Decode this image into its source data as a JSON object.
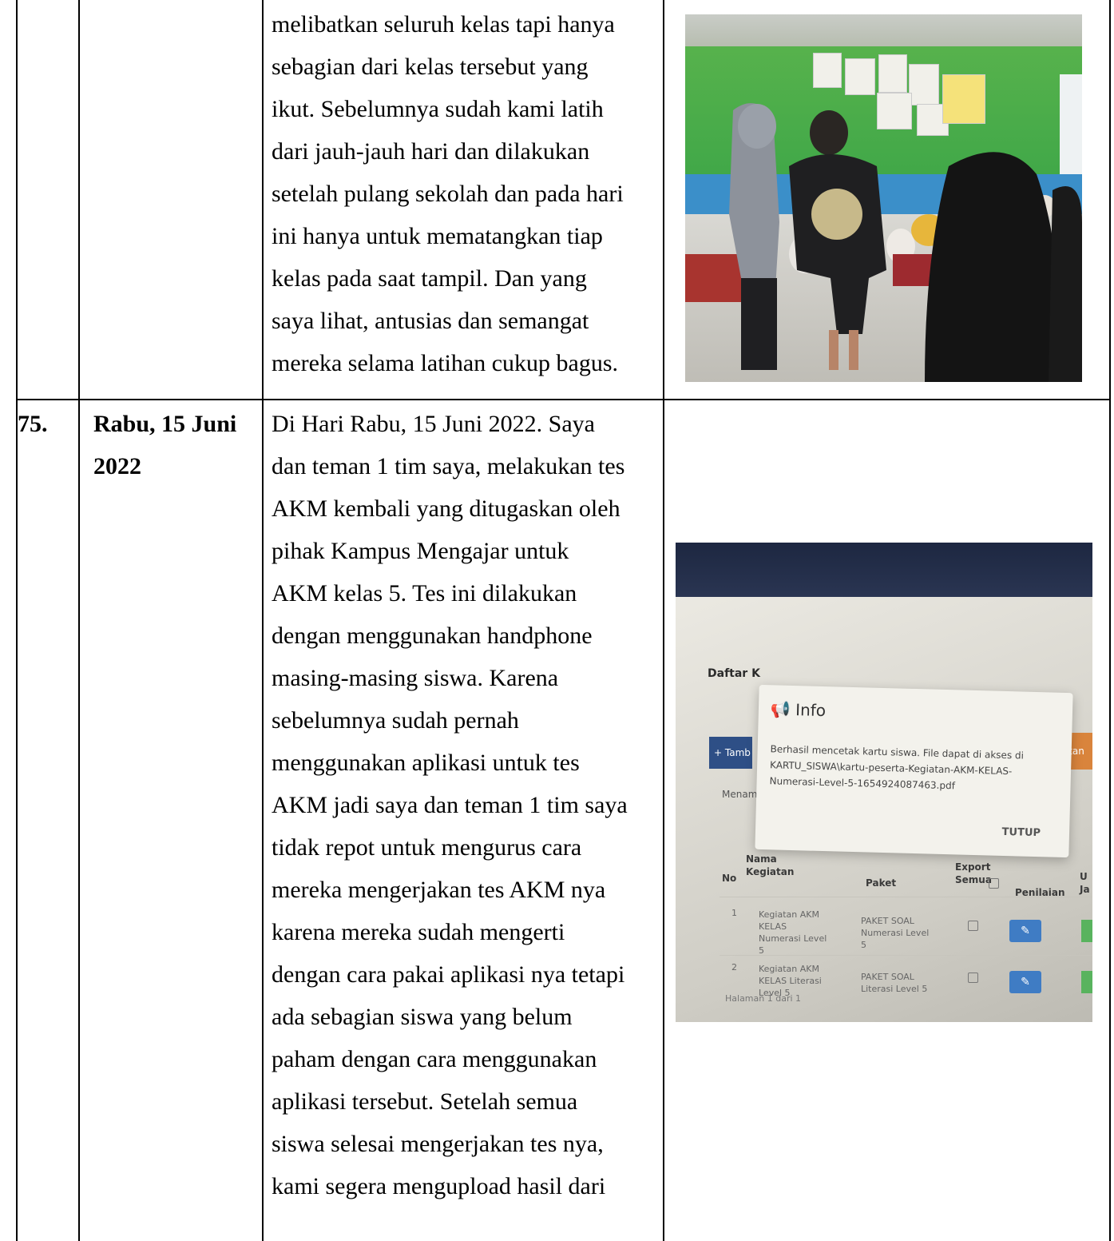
{
  "row_top": {
    "text_lines": [
      "melibatkan seluruh kelas tapi hanya",
      "sebagian dari kelas tersebut yang",
      "ikut. Sebelumnya sudah kami latih",
      "dari jauh-jauh hari dan dilakukan",
      "setelah pulang sekolah dan pada hari",
      "ini hanya untuk mematangkan tiap",
      "kelas pada saat tampil. Dan yang",
      "saya lihat, antusias dan semangat",
      "mereka selama latihan cukup bagus."
    ]
  },
  "row_75": {
    "number": "75.",
    "date_lines": [
      "Rabu, 15 Juni",
      "2022"
    ],
    "text_lines": [
      "Di Hari Rabu, 15 Juni 2022. Saya",
      "dan teman 1 tim saya, melakukan tes",
      "AKM kembali yang ditugaskan oleh",
      "pihak Kampus Mengajar untuk",
      "AKM kelas 5. Tes ini dilakukan",
      "dengan menggunakan handphone",
      "masing-masing siswa. Karena",
      "sebelumnya sudah pernah",
      "menggunakan aplikasi untuk tes",
      "AKM jadi saya dan teman 1 tim saya",
      "tidak repot untuk mengurus cara",
      "mereka mengerjakan tes AKM nya",
      "karena mereka sudah mengerti",
      "dengan cara pakai aplikasi nya tetapi",
      "ada sebagian siswa yang belum",
      "paham dengan cara menggunakan",
      "aplikasi tersebut. Setelah semua",
      "siswa selesai mengerjakan tes nya,",
      "kami segera mengupload hasil dari"
    ]
  },
  "screen_photo": {
    "page_title": "Daftar K",
    "add_button": "+ Tamb",
    "side_button": "tan",
    "menam_label": "Menam",
    "dialog": {
      "title": "Info",
      "message": "Berhasil mencetak kartu siswa. File dapat di akses di\nKARTU_SISWA\\kartu-peserta-Kegiatan-AKM-KELAS-\nNumerasi-Level-5-1654924087463.pdf",
      "close_label": "TUTUP"
    },
    "table": {
      "headers": {
        "no": "No",
        "nama_kegiatan": "Nama\nKegiatan",
        "paket": "Paket",
        "export_semua": "Export\nSemua",
        "penilaian": "Penilaian",
        "extra": "U\nJa"
      },
      "rows": [
        {
          "no": "1",
          "kegiatan": "Kegiatan AKM KELAS Numerasi Level 5",
          "paket": "PAKET SOAL Numerasi Level 5"
        },
        {
          "no": "2",
          "kegiatan": "Kegiatan AKM KELAS Literasi Level 5",
          "paket": "PAKET SOAL Literasi Level 5"
        }
      ]
    },
    "footer": "Halaman 1 dari 1"
  }
}
